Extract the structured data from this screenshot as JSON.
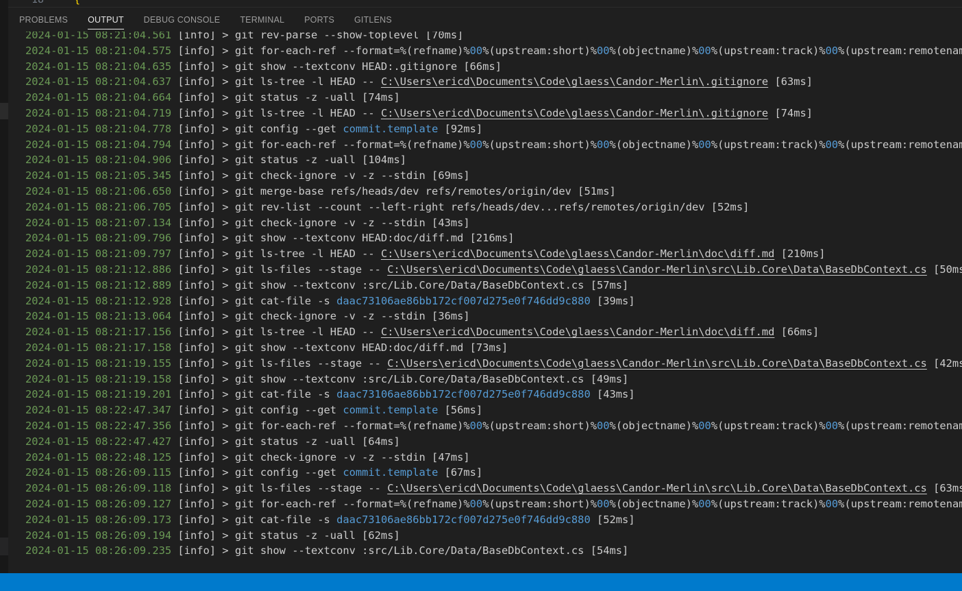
{
  "editor": {
    "line_number": "18",
    "bracket": "{"
  },
  "panel": {
    "tabs": [
      {
        "label": "PROBLEMS",
        "active": false
      },
      {
        "label": "OUTPUT",
        "active": true
      },
      {
        "label": "DEBUG CONSOLE",
        "active": false
      },
      {
        "label": "TERMINAL",
        "active": false
      },
      {
        "label": "PORTS",
        "active": false
      },
      {
        "label": "GITLENS",
        "active": false
      }
    ]
  },
  "colors": {
    "timestamp": "#6a9955",
    "text": "#cccccc",
    "highlight": "#569cd6",
    "background": "#1f1f1f",
    "status_bar": "#007acc"
  },
  "log_lines": [
    {
      "ts": "2024-01-15 08:21:04.561",
      "lvl": "[info]",
      "parts": [
        {
          "t": " > git rev-parse --show-toplevel [70ms]"
        }
      ]
    },
    {
      "ts": "2024-01-15 08:21:04.575",
      "lvl": "[info]",
      "parts": [
        {
          "t": " > git for-each-ref --format=%(refname)%"
        },
        {
          "t": "00",
          "c": "hl"
        },
        {
          "t": "%(upstream:short)%"
        },
        {
          "t": "00",
          "c": "hl"
        },
        {
          "t": "%(objectname)%"
        },
        {
          "t": "00",
          "c": "hl"
        },
        {
          "t": "%(upstream:track)%"
        },
        {
          "t": "00",
          "c": "hl"
        },
        {
          "t": "%(upstream:remotenam"
        }
      ]
    },
    {
      "ts": "2024-01-15 08:21:04.635",
      "lvl": "[info]",
      "parts": [
        {
          "t": " > git show --textconv HEAD:.gitignore [66ms]"
        }
      ]
    },
    {
      "ts": "2024-01-15 08:21:04.637",
      "lvl": "[info]",
      "parts": [
        {
          "t": " > git ls-tree -l HEAD -- "
        },
        {
          "t": "C:\\Users\\ericd\\Documents\\Code\\glaess\\Candor-Merlin\\.gitignore",
          "c": "link"
        },
        {
          "t": " [63ms]"
        }
      ]
    },
    {
      "ts": "2024-01-15 08:21:04.664",
      "lvl": "[info]",
      "parts": [
        {
          "t": " > git status -z -uall [74ms]"
        }
      ]
    },
    {
      "ts": "2024-01-15 08:21:04.719",
      "lvl": "[info]",
      "parts": [
        {
          "t": " > git ls-tree -l HEAD -- "
        },
        {
          "t": "C:\\Users\\ericd\\Documents\\Code\\glaess\\Candor-Merlin\\.gitignore",
          "c": "link"
        },
        {
          "t": " [74ms]"
        }
      ]
    },
    {
      "ts": "2024-01-15 08:21:04.778",
      "lvl": "[info]",
      "parts": [
        {
          "t": " > git config --get "
        },
        {
          "t": "commit.template",
          "c": "hl"
        },
        {
          "t": " [92ms]"
        }
      ]
    },
    {
      "ts": "2024-01-15 08:21:04.794",
      "lvl": "[info]",
      "parts": [
        {
          "t": " > git for-each-ref --format=%(refname)%"
        },
        {
          "t": "00",
          "c": "hl"
        },
        {
          "t": "%(upstream:short)%"
        },
        {
          "t": "00",
          "c": "hl"
        },
        {
          "t": "%(objectname)%"
        },
        {
          "t": "00",
          "c": "hl"
        },
        {
          "t": "%(upstream:track)%"
        },
        {
          "t": "00",
          "c": "hl"
        },
        {
          "t": "%(upstream:remotenam"
        }
      ]
    },
    {
      "ts": "2024-01-15 08:21:04.906",
      "lvl": "[info]",
      "parts": [
        {
          "t": " > git status -z -uall [104ms]"
        }
      ]
    },
    {
      "ts": "2024-01-15 08:21:05.345",
      "lvl": "[info]",
      "parts": [
        {
          "t": " > git check-ignore -v -z --stdin [69ms]"
        }
      ]
    },
    {
      "ts": "2024-01-15 08:21:06.650",
      "lvl": "[info]",
      "parts": [
        {
          "t": " > git merge-base refs/heads/dev refs/remotes/origin/dev [51ms]"
        }
      ]
    },
    {
      "ts": "2024-01-15 08:21:06.705",
      "lvl": "[info]",
      "parts": [
        {
          "t": " > git rev-list --count --left-right refs/heads/dev...refs/remotes/origin/dev [52ms]"
        }
      ]
    },
    {
      "ts": "2024-01-15 08:21:07.134",
      "lvl": "[info]",
      "parts": [
        {
          "t": " > git check-ignore -v -z --stdin [43ms]"
        }
      ]
    },
    {
      "ts": "2024-01-15 08:21:09.796",
      "lvl": "[info]",
      "parts": [
        {
          "t": " > git show --textconv HEAD:doc/diff.md [216ms]"
        }
      ]
    },
    {
      "ts": "2024-01-15 08:21:09.797",
      "lvl": "[info]",
      "parts": [
        {
          "t": " > git ls-tree -l HEAD -- "
        },
        {
          "t": "C:\\Users\\ericd\\Documents\\Code\\glaess\\Candor-Merlin\\doc\\diff.md",
          "c": "link"
        },
        {
          "t": " [210ms]"
        }
      ]
    },
    {
      "ts": "2024-01-15 08:21:12.886",
      "lvl": "[info]",
      "parts": [
        {
          "t": " > git ls-files --stage -- "
        },
        {
          "t": "C:\\Users\\ericd\\Documents\\Code\\glaess\\Candor-Merlin\\src\\Lib.Core\\Data\\BaseDbContext.cs",
          "c": "link"
        },
        {
          "t": " [50ms"
        }
      ]
    },
    {
      "ts": "2024-01-15 08:21:12.889",
      "lvl": "[info]",
      "parts": [
        {
          "t": " > git show --textconv :src/Lib.Core/Data/BaseDbContext.cs [57ms]"
        }
      ]
    },
    {
      "ts": "2024-01-15 08:21:12.928",
      "lvl": "[info]",
      "parts": [
        {
          "t": " > git cat-file -s "
        },
        {
          "t": "daac73106ae86bb172cf007d275e0f746dd9c880",
          "c": "hl"
        },
        {
          "t": " [39ms]"
        }
      ]
    },
    {
      "ts": "2024-01-15 08:21:13.064",
      "lvl": "[info]",
      "parts": [
        {
          "t": " > git check-ignore -v -z --stdin [36ms]"
        }
      ]
    },
    {
      "ts": "2024-01-15 08:21:17.156",
      "lvl": "[info]",
      "parts": [
        {
          "t": " > git ls-tree -l HEAD -- "
        },
        {
          "t": "C:\\Users\\ericd\\Documents\\Code\\glaess\\Candor-Merlin\\doc\\diff.md",
          "c": "link"
        },
        {
          "t": " [66ms]"
        }
      ]
    },
    {
      "ts": "2024-01-15 08:21:17.158",
      "lvl": "[info]",
      "parts": [
        {
          "t": " > git show --textconv HEAD:doc/diff.md [73ms]"
        }
      ]
    },
    {
      "ts": "2024-01-15 08:21:19.155",
      "lvl": "[info]",
      "parts": [
        {
          "t": " > git ls-files --stage -- "
        },
        {
          "t": "C:\\Users\\ericd\\Documents\\Code\\glaess\\Candor-Merlin\\src\\Lib.Core\\Data\\BaseDbContext.cs",
          "c": "link"
        },
        {
          "t": " [42ms"
        }
      ]
    },
    {
      "ts": "2024-01-15 08:21:19.158",
      "lvl": "[info]",
      "parts": [
        {
          "t": " > git show --textconv :src/Lib.Core/Data/BaseDbContext.cs [49ms]"
        }
      ]
    },
    {
      "ts": "2024-01-15 08:21:19.201",
      "lvl": "[info]",
      "parts": [
        {
          "t": " > git cat-file -s "
        },
        {
          "t": "daac73106ae86bb172cf007d275e0f746dd9c880",
          "c": "hl"
        },
        {
          "t": " [43ms]"
        }
      ]
    },
    {
      "ts": "2024-01-15 08:22:47.347",
      "lvl": "[info]",
      "parts": [
        {
          "t": " > git config --get "
        },
        {
          "t": "commit.template",
          "c": "hl"
        },
        {
          "t": " [56ms]"
        }
      ]
    },
    {
      "ts": "2024-01-15 08:22:47.356",
      "lvl": "[info]",
      "parts": [
        {
          "t": " > git for-each-ref --format=%(refname)%"
        },
        {
          "t": "00",
          "c": "hl"
        },
        {
          "t": "%(upstream:short)%"
        },
        {
          "t": "00",
          "c": "hl"
        },
        {
          "t": "%(objectname)%"
        },
        {
          "t": "00",
          "c": "hl"
        },
        {
          "t": "%(upstream:track)%"
        },
        {
          "t": "00",
          "c": "hl"
        },
        {
          "t": "%(upstream:remotenam"
        }
      ]
    },
    {
      "ts": "2024-01-15 08:22:47.427",
      "lvl": "[info]",
      "parts": [
        {
          "t": " > git status -z -uall [64ms]"
        }
      ]
    },
    {
      "ts": "2024-01-15 08:22:48.125",
      "lvl": "[info]",
      "parts": [
        {
          "t": " > git check-ignore -v -z --stdin [47ms]"
        }
      ]
    },
    {
      "ts": "2024-01-15 08:26:09.115",
      "lvl": "[info]",
      "parts": [
        {
          "t": " > git config --get "
        },
        {
          "t": "commit.template",
          "c": "hl"
        },
        {
          "t": " [67ms]"
        }
      ]
    },
    {
      "ts": "2024-01-15 08:26:09.118",
      "lvl": "[info]",
      "parts": [
        {
          "t": " > git ls-files --stage -- "
        },
        {
          "t": "C:\\Users\\ericd\\Documents\\Code\\glaess\\Candor-Merlin\\src\\Lib.Core\\Data\\BaseDbContext.cs",
          "c": "link"
        },
        {
          "t": " [63ms"
        }
      ]
    },
    {
      "ts": "2024-01-15 08:26:09.127",
      "lvl": "[info]",
      "parts": [
        {
          "t": " > git for-each-ref --format=%(refname)%"
        },
        {
          "t": "00",
          "c": "hl"
        },
        {
          "t": "%(upstream:short)%"
        },
        {
          "t": "00",
          "c": "hl"
        },
        {
          "t": "%(objectname)%"
        },
        {
          "t": "00",
          "c": "hl"
        },
        {
          "t": "%(upstream:track)%"
        },
        {
          "t": "00",
          "c": "hl"
        },
        {
          "t": "%(upstream:remotenam"
        }
      ]
    },
    {
      "ts": "2024-01-15 08:26:09.173",
      "lvl": "[info]",
      "parts": [
        {
          "t": " > git cat-file -s "
        },
        {
          "t": "daac73106ae86bb172cf007d275e0f746dd9c880",
          "c": "hl"
        },
        {
          "t": " [52ms]"
        }
      ]
    },
    {
      "ts": "2024-01-15 08:26:09.194",
      "lvl": "[info]",
      "parts": [
        {
          "t": " > git status -z -uall [62ms]"
        }
      ]
    },
    {
      "ts": "2024-01-15 08:26:09.235",
      "lvl": "[info]",
      "parts": [
        {
          "t": " > git show --textconv :src/Lib.Core/Data/BaseDbContext.cs [54ms]"
        }
      ]
    }
  ]
}
